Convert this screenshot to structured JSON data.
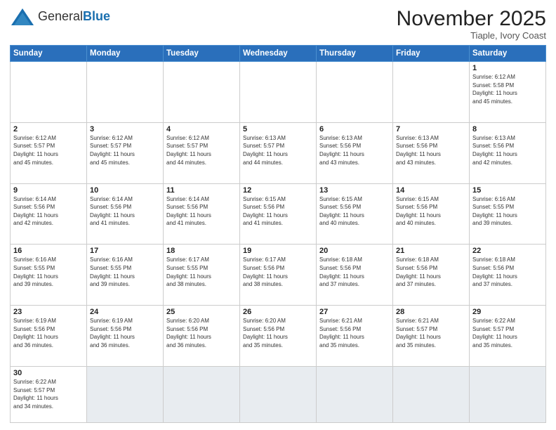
{
  "logo": {
    "text_general": "General",
    "text_blue": "Blue"
  },
  "header": {
    "month": "November 2025",
    "location": "Tiaple, Ivory Coast"
  },
  "weekdays": [
    "Sunday",
    "Monday",
    "Tuesday",
    "Wednesday",
    "Thursday",
    "Friday",
    "Saturday"
  ],
  "weeks": [
    [
      {
        "day": "",
        "info": ""
      },
      {
        "day": "",
        "info": ""
      },
      {
        "day": "",
        "info": ""
      },
      {
        "day": "",
        "info": ""
      },
      {
        "day": "",
        "info": ""
      },
      {
        "day": "",
        "info": ""
      },
      {
        "day": "1",
        "info": "Sunrise: 6:12 AM\nSunset: 5:58 PM\nDaylight: 11 hours\nand 45 minutes."
      }
    ],
    [
      {
        "day": "2",
        "info": "Sunrise: 6:12 AM\nSunset: 5:57 PM\nDaylight: 11 hours\nand 45 minutes."
      },
      {
        "day": "3",
        "info": "Sunrise: 6:12 AM\nSunset: 5:57 PM\nDaylight: 11 hours\nand 45 minutes."
      },
      {
        "day": "4",
        "info": "Sunrise: 6:12 AM\nSunset: 5:57 PM\nDaylight: 11 hours\nand 44 minutes."
      },
      {
        "day": "5",
        "info": "Sunrise: 6:13 AM\nSunset: 5:57 PM\nDaylight: 11 hours\nand 44 minutes."
      },
      {
        "day": "6",
        "info": "Sunrise: 6:13 AM\nSunset: 5:56 PM\nDaylight: 11 hours\nand 43 minutes."
      },
      {
        "day": "7",
        "info": "Sunrise: 6:13 AM\nSunset: 5:56 PM\nDaylight: 11 hours\nand 43 minutes."
      },
      {
        "day": "8",
        "info": "Sunrise: 6:13 AM\nSunset: 5:56 PM\nDaylight: 11 hours\nand 42 minutes."
      }
    ],
    [
      {
        "day": "9",
        "info": "Sunrise: 6:14 AM\nSunset: 5:56 PM\nDaylight: 11 hours\nand 42 minutes."
      },
      {
        "day": "10",
        "info": "Sunrise: 6:14 AM\nSunset: 5:56 PM\nDaylight: 11 hours\nand 41 minutes."
      },
      {
        "day": "11",
        "info": "Sunrise: 6:14 AM\nSunset: 5:56 PM\nDaylight: 11 hours\nand 41 minutes."
      },
      {
        "day": "12",
        "info": "Sunrise: 6:15 AM\nSunset: 5:56 PM\nDaylight: 11 hours\nand 41 minutes."
      },
      {
        "day": "13",
        "info": "Sunrise: 6:15 AM\nSunset: 5:56 PM\nDaylight: 11 hours\nand 40 minutes."
      },
      {
        "day": "14",
        "info": "Sunrise: 6:15 AM\nSunset: 5:56 PM\nDaylight: 11 hours\nand 40 minutes."
      },
      {
        "day": "15",
        "info": "Sunrise: 6:16 AM\nSunset: 5:55 PM\nDaylight: 11 hours\nand 39 minutes."
      }
    ],
    [
      {
        "day": "16",
        "info": "Sunrise: 6:16 AM\nSunset: 5:55 PM\nDaylight: 11 hours\nand 39 minutes."
      },
      {
        "day": "17",
        "info": "Sunrise: 6:16 AM\nSunset: 5:55 PM\nDaylight: 11 hours\nand 39 minutes."
      },
      {
        "day": "18",
        "info": "Sunrise: 6:17 AM\nSunset: 5:55 PM\nDaylight: 11 hours\nand 38 minutes."
      },
      {
        "day": "19",
        "info": "Sunrise: 6:17 AM\nSunset: 5:56 PM\nDaylight: 11 hours\nand 38 minutes."
      },
      {
        "day": "20",
        "info": "Sunrise: 6:18 AM\nSunset: 5:56 PM\nDaylight: 11 hours\nand 37 minutes."
      },
      {
        "day": "21",
        "info": "Sunrise: 6:18 AM\nSunset: 5:56 PM\nDaylight: 11 hours\nand 37 minutes."
      },
      {
        "day": "22",
        "info": "Sunrise: 6:18 AM\nSunset: 5:56 PM\nDaylight: 11 hours\nand 37 minutes."
      }
    ],
    [
      {
        "day": "23",
        "info": "Sunrise: 6:19 AM\nSunset: 5:56 PM\nDaylight: 11 hours\nand 36 minutes."
      },
      {
        "day": "24",
        "info": "Sunrise: 6:19 AM\nSunset: 5:56 PM\nDaylight: 11 hours\nand 36 minutes."
      },
      {
        "day": "25",
        "info": "Sunrise: 6:20 AM\nSunset: 5:56 PM\nDaylight: 11 hours\nand 36 minutes."
      },
      {
        "day": "26",
        "info": "Sunrise: 6:20 AM\nSunset: 5:56 PM\nDaylight: 11 hours\nand 35 minutes."
      },
      {
        "day": "27",
        "info": "Sunrise: 6:21 AM\nSunset: 5:56 PM\nDaylight: 11 hours\nand 35 minutes."
      },
      {
        "day": "28",
        "info": "Sunrise: 6:21 AM\nSunset: 5:57 PM\nDaylight: 11 hours\nand 35 minutes."
      },
      {
        "day": "29",
        "info": "Sunrise: 6:22 AM\nSunset: 5:57 PM\nDaylight: 11 hours\nand 35 minutes."
      }
    ],
    [
      {
        "day": "30",
        "info": "Sunrise: 6:22 AM\nSunset: 5:57 PM\nDaylight: 11 hours\nand 34 minutes."
      },
      {
        "day": "",
        "info": ""
      },
      {
        "day": "",
        "info": ""
      },
      {
        "day": "",
        "info": ""
      },
      {
        "day": "",
        "info": ""
      },
      {
        "day": "",
        "info": ""
      },
      {
        "day": "",
        "info": ""
      }
    ]
  ]
}
